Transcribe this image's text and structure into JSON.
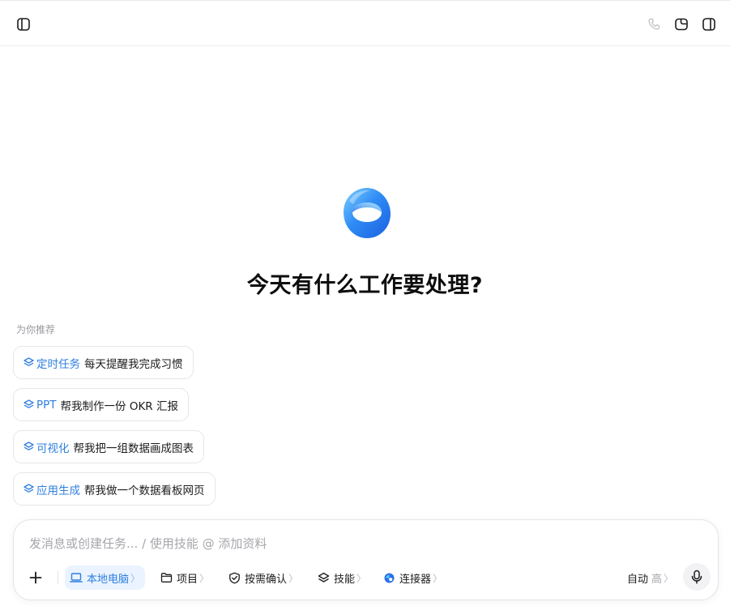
{
  "topbar": {
    "left_icon": "sidebar-toggle-icon",
    "right_icons": [
      "phone-icon",
      "new-chat-icon",
      "right-panel-icon"
    ]
  },
  "hero": {
    "logo_icon": "app-logo-icon",
    "title": "今天有什么工作要处理?"
  },
  "recommendations": {
    "label": "为你推荐",
    "items": [
      {
        "tag": "定时任务",
        "text": "每天提醒我完成习惯",
        "icon": "layers-icon"
      },
      {
        "tag": "PPT",
        "text": "帮我制作一份 OKR 汇报",
        "icon": "layers-icon"
      },
      {
        "tag": "可视化",
        "text": "帮我把一组数据画成图表",
        "icon": "layers-icon"
      },
      {
        "tag": "应用生成",
        "text": "帮我做一个数据看板网页",
        "icon": "layers-icon"
      }
    ]
  },
  "composer": {
    "placeholder": "发消息或创建任务... / 使用技能 @ 添加资料",
    "value": "",
    "add_icon": "plus-icon",
    "tools": {
      "local": {
        "label": "本地电脑",
        "chevron": "〉",
        "icon": "laptop-icon"
      },
      "project": {
        "label": "项目",
        "chevron": "〉",
        "icon": "folder-icon"
      },
      "confirm": {
        "label": "按需确认",
        "chevron": "〉",
        "icon": "check-circle-icon"
      },
      "skills": {
        "label": "技能",
        "chevron": "〉",
        "icon": "layers-icon"
      },
      "connector": {
        "label": "连接器",
        "chevron": "〉",
        "icon": "connector-icon"
      }
    },
    "mode": {
      "label": "自动",
      "level": "高",
      "chevron": "〉"
    },
    "mic_icon": "microphone-icon"
  },
  "colors": {
    "accent": "#2f7fe0",
    "active_bg": "#eaf3ff",
    "border": "#e6e6ea",
    "muted_text": "#a6a6ac"
  }
}
